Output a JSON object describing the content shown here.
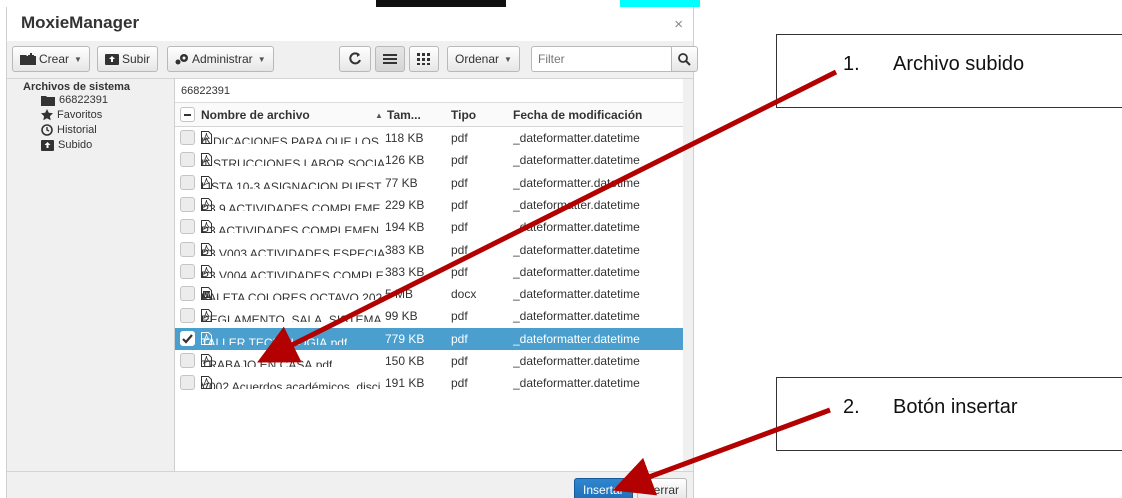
{
  "dialog": {
    "title": "MoxieManager",
    "close_symbol": "×"
  },
  "toolbar": {
    "create_label": "Crear",
    "upload_label": "Subir",
    "manage_label": "Administrar",
    "sort_label": "Ordenar",
    "filter_placeholder": "Filter"
  },
  "sidebar": {
    "root_label": "Archivos de sistema",
    "items": [
      {
        "label": "66822391",
        "icon": "folder-icon"
      },
      {
        "label": "Favoritos",
        "icon": "star-icon"
      },
      {
        "label": "Historial",
        "icon": "history-icon"
      },
      {
        "label": "Subido",
        "icon": "upload-icon"
      }
    ]
  },
  "panel": {
    "path": "66822391",
    "columns": {
      "name": "Nombre de archivo",
      "size": "Tam...",
      "type": "Tipo",
      "date": "Fecha de modificación"
    },
    "rows": [
      {
        "name": "INDICACIONES PARA QUE LOS",
        "size": "118 KB",
        "type": "pdf",
        "date": "_dateformatter.datetime",
        "icon": "pdf-icon",
        "selected": false
      },
      {
        "name": "INSTRUCCIONES LABOR SOCIA",
        "size": "126 KB",
        "type": "pdf",
        "date": "_dateformatter.datetime",
        "icon": "pdf-icon",
        "selected": false
      },
      {
        "name": "LISTA 10-3 ASIGNACION PUEST",
        "size": "77 KB",
        "type": "pdf",
        "date": "_dateformatter.datetime",
        "icon": "pdf-icon",
        "selected": false
      },
      {
        "name": "P3 9 ACTIVIDADES COMPLEME",
        "size": "229 KB",
        "type": "pdf",
        "date": "_dateformatter.datetime",
        "icon": "pdf-icon",
        "selected": false
      },
      {
        "name": "P3 ACTIVIDADES COMPLEMEN",
        "size": "194 KB",
        "type": "pdf",
        "date": "_dateformatter.datetime",
        "icon": "pdf-icon",
        "selected": false
      },
      {
        "name": "P3 V003 ACTIVIDADES ESPECIA",
        "size": "383 KB",
        "type": "pdf",
        "date": "_dateformatter.datetime",
        "icon": "pdf-icon",
        "selected": false
      },
      {
        "name": "P3 V004 ACTIVIDADES COMPLE",
        "size": "383 KB",
        "type": "pdf",
        "date": "_dateformatter.datetime",
        "icon": "pdf-icon",
        "selected": false
      },
      {
        "name": "PALETA COLORES OCTAVO 202",
        "size": "5 MB",
        "type": "docx",
        "date": "_dateformatter.datetime",
        "icon": "word-icon",
        "selected": false
      },
      {
        "name": "REGLAMENTO_SALA_SISTEMA",
        "size": "99 KB",
        "type": "pdf",
        "date": "_dateformatter.datetime",
        "icon": "pdf-icon",
        "selected": false
      },
      {
        "name": "TALLER TECNOLOGIA.pdf",
        "size": "779 KB",
        "type": "pdf",
        "date": "_dateformatter.datetime",
        "icon": "pdf-icon",
        "selected": true
      },
      {
        "name": "TRABAJO EN CASA.pdf",
        "size": "150 KB",
        "type": "pdf",
        "date": "_dateformatter.datetime",
        "icon": "pdf-icon",
        "selected": false
      },
      {
        "name": "V002 Acuerdos académicos, disci",
        "size": "191 KB",
        "type": "pdf",
        "date": "_dateformatter.datetime",
        "icon": "pdf-icon",
        "selected": false
      }
    ]
  },
  "footer": {
    "insert_label": "Insertar",
    "close_label": "Cerrar"
  },
  "callouts": [
    {
      "number": "1.",
      "text": "Archivo subido"
    },
    {
      "number": "2.",
      "text": "Botón insertar"
    }
  ],
  "colors": {
    "selection": "#4a9fce",
    "insert_button": "#1d6fb8",
    "arrow": "#b30000",
    "accent_strip": "#00ffff"
  }
}
